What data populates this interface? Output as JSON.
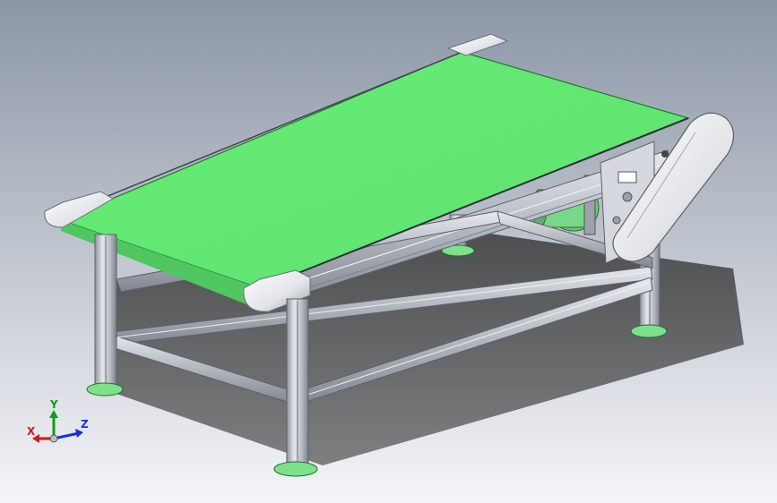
{
  "background": {
    "top_color": "#8c96a6",
    "bottom_color": "#f4f5f8"
  },
  "model": {
    "belt_color": "#66ee77",
    "belt_edge_color": "#1f7a2a",
    "frame_color": "#c8ccd3",
    "foot_color": "#7be28a"
  },
  "triad": {
    "x_label": "X",
    "y_label": "Y",
    "z_label": "Z",
    "x_color": "#d01818",
    "y_color": "#10a010",
    "z_color": "#1830d8"
  }
}
